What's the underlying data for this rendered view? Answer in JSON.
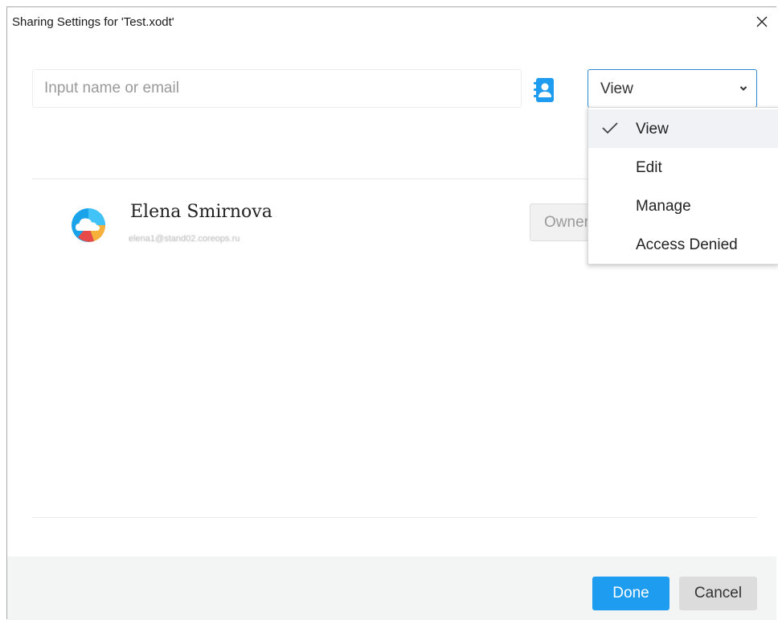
{
  "dialog": {
    "title": "Sharing Settings for 'Test.xodt'"
  },
  "search": {
    "placeholder": "Input name or email",
    "value": ""
  },
  "access_select": {
    "selected": "View"
  },
  "access_menu": {
    "items": [
      {
        "label": "View",
        "checked": true
      },
      {
        "label": "Edit",
        "checked": false
      },
      {
        "label": "Manage",
        "checked": false
      },
      {
        "label": "Access Denied",
        "checked": false
      }
    ]
  },
  "users": [
    {
      "name": "Elena Smirnova",
      "email": "elena1@stand02.coreops.ru",
      "role_label": "Owner"
    }
  ],
  "footer": {
    "done_label": "Done",
    "cancel_label": "Cancel"
  },
  "colors": {
    "accent": "#1e9cf0",
    "select_border": "#2e88d0",
    "footer_bg": "#f3f4f4"
  },
  "icons": {
    "close": "close-icon",
    "contacts": "address-book-icon",
    "chevron": "chevron-down-icon",
    "check": "checkmark-icon",
    "avatar": "cloud-logo-icon"
  }
}
